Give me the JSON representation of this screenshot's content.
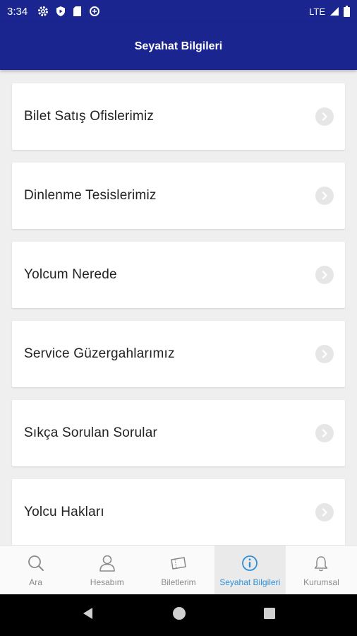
{
  "status_bar": {
    "time": "3:34",
    "network": "LTE"
  },
  "header": {
    "title": "Seyahat Bilgileri"
  },
  "menu": {
    "items": [
      {
        "label": "Bilet Satış Ofislerimiz"
      },
      {
        "label": "Dinlenme Tesislerimiz"
      },
      {
        "label": "Yolcum Nerede"
      },
      {
        "label": "Service Güzergahlarımız"
      },
      {
        "label": "Sıkça Sorulan Sorular"
      },
      {
        "label": "Yolcu Hakları"
      }
    ]
  },
  "bottom_nav": {
    "items": [
      {
        "label": "Ara",
        "icon": "search-icon"
      },
      {
        "label": "Hesabım",
        "icon": "user-icon"
      },
      {
        "label": "Biletlerim",
        "icon": "ticket-icon"
      },
      {
        "label": "Seyahat Bilgileri",
        "icon": "info-icon",
        "active": true
      },
      {
        "label": "Kurumsal",
        "icon": "bell-icon"
      }
    ]
  },
  "colors": {
    "primary": "#1a2590",
    "active_nav": "#2e8fd8",
    "background": "#efefef"
  }
}
